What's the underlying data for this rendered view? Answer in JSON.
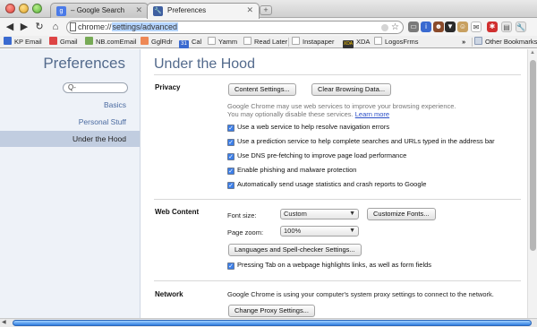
{
  "tabs": [
    {
      "title": "Google Search",
      "prefix": "–",
      "favicon": "google-g-icon",
      "active": false
    },
    {
      "title": "Preferences",
      "favicon": "wrench-icon",
      "active": true
    }
  ],
  "toolbar": {
    "url_prefix": "chrome://",
    "url_highlight": "settings/advanced",
    "extension_icons": [
      "page-action-icon",
      "info-icon",
      "grease-monkey-icon",
      "skype-icon",
      "ad-block-icon",
      "delicious-icon",
      "gmail-checker-icon",
      "evernote-icon",
      "cookie-icon",
      "lastpass-icon",
      "page-icon",
      "wrench-menu-icon"
    ]
  },
  "bookmarks": [
    {
      "label": "KP Email"
    },
    {
      "label": "Gmail"
    },
    {
      "label": "NB.comEmail"
    },
    {
      "label": "GglRdr"
    },
    {
      "label": "Cal",
      "badge": "31"
    },
    {
      "label": "Yamm"
    },
    {
      "label": "Read Later"
    },
    {
      "label": "Instapaper"
    },
    {
      "label": "XDA",
      "badge": "XDA"
    },
    {
      "label": "LogosFrms"
    },
    {
      "label": "»"
    },
    {
      "label": "Other Bookmarks"
    }
  ],
  "sidebar": {
    "title": "Preferences",
    "search_placeholder": "Q-",
    "items": [
      {
        "label": "Basics"
      },
      {
        "label": "Personal Stuff"
      },
      {
        "label": "Under the Hood",
        "selected": true
      }
    ]
  },
  "main": {
    "title": "Under the Hood",
    "privacy": {
      "heading": "Privacy",
      "content_settings": "Content Settings...",
      "clear_data": "Clear Browsing Data...",
      "desc1": "Google Chrome may use web services to improve your browsing experience.",
      "desc2": "You may optionally disable these services.",
      "learn_more": "Learn more",
      "checkboxes": [
        {
          "label": "Use a web service to help resolve navigation errors",
          "checked": true
        },
        {
          "label": "Use a prediction service to help complete searches and URLs typed in the address bar",
          "checked": true
        },
        {
          "label": "Use DNS pre-fetching to improve page load performance",
          "checked": true
        },
        {
          "label": "Enable phishing and malware protection",
          "checked": true
        },
        {
          "label": "Automatically send usage statistics and crash reports to Google",
          "checked": true
        }
      ]
    },
    "web_content": {
      "heading": "Web Content",
      "font_size_label": "Font size:",
      "font_size_value": "Custom",
      "customize_fonts": "Customize Fonts...",
      "page_zoom_label": "Page zoom:",
      "page_zoom_value": "100%",
      "languages_button": "Languages and Spell-checker Settings...",
      "tab_checkbox": "Pressing Tab on a webpage highlights links, as well as form fields"
    },
    "network": {
      "heading": "Network",
      "desc": "Google Chrome is using your computer's system proxy settings to connect to the network.",
      "proxy_button": "Change Proxy Settings..."
    }
  }
}
